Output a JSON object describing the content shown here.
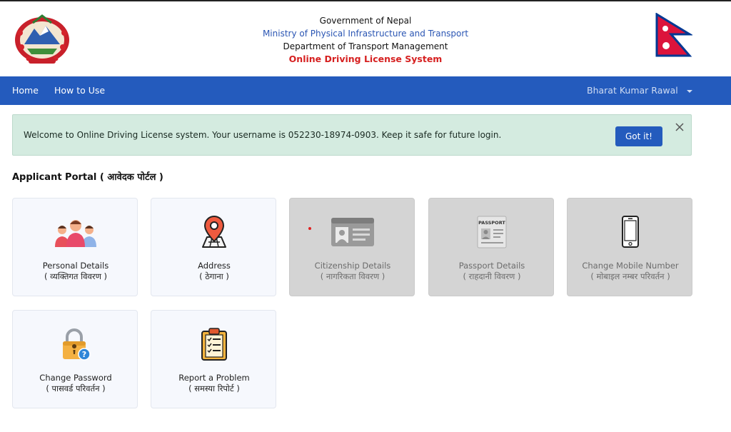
{
  "header": {
    "government": "Government of Nepal",
    "ministry": "Ministry of Physical Infrastructure and Transport",
    "department": "Department of Transport Management",
    "system": "Online Driving License System",
    "emblem_icon": "nepal-emblem-icon",
    "flag_icon": "nepal-flag-icon"
  },
  "nav": {
    "home": "Home",
    "how_to_use": "How to Use",
    "user_name": "Bharat Kumar Rawal",
    "bar_color": "#245bbd"
  },
  "alert": {
    "message": "Welcome to Online Driving License system. Your username is 052230-18974-0903. Keep it safe for future login.",
    "button_label": "Got it!",
    "background": "#d4ebe0"
  },
  "portal": {
    "title": "Applicant Portal ( आवेदक पोर्टल )",
    "cards": [
      {
        "title": "Personal Details",
        "subtitle": "( व्यक्तिगत विवरण )",
        "icon": "family-icon",
        "enabled": true
      },
      {
        "title": "Address",
        "subtitle": "( ठेगाना )",
        "icon": "location-pin-icon",
        "enabled": true
      },
      {
        "title": "Citizenship Details",
        "subtitle": "( नागरिकता विवरण )",
        "icon": "id-card-icon",
        "enabled": false
      },
      {
        "title": "Passport Details",
        "subtitle": "( राहदानी विवरण )",
        "icon": "passport-icon",
        "enabled": false
      },
      {
        "title": "Change Mobile Number",
        "subtitle": "( मोबाइल नम्बर परिवर्तन )",
        "icon": "mobile-phone-icon",
        "enabled": false
      },
      {
        "title": "Change Password",
        "subtitle": "( पासवर्ड परिवर्तन )",
        "icon": "lock-question-icon",
        "enabled": true
      },
      {
        "title": "Report a Problem",
        "subtitle": "( समस्या रिपोर्ट )",
        "icon": "clipboard-checklist-icon",
        "enabled": true
      }
    ]
  }
}
